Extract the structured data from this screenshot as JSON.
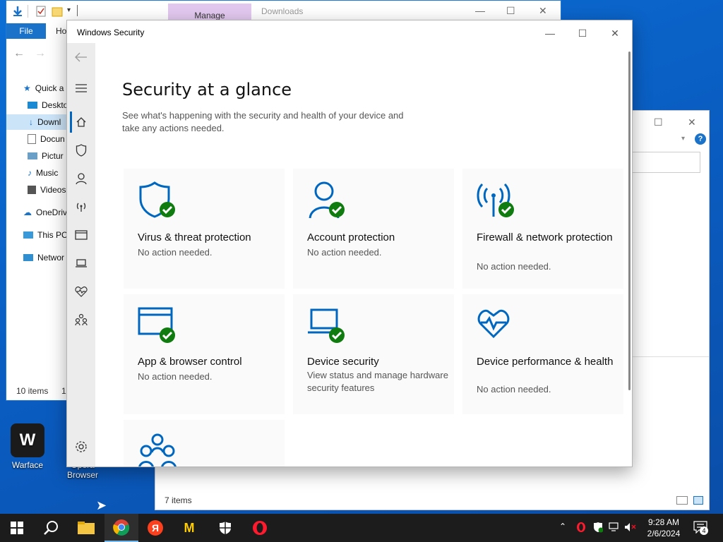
{
  "explorer": {
    "ribbon_tab_file": "File",
    "ribbon_tab_home": "Ho",
    "manage_tab": "Manage",
    "title": "Downloads",
    "sidebar": [
      {
        "label": "Quick a",
        "icon": "star-icon"
      },
      {
        "label": "Deskto",
        "icon": "desktop-icon"
      },
      {
        "label": "Downl",
        "icon": "download-icon"
      },
      {
        "label": "Docun",
        "icon": "document-icon"
      },
      {
        "label": "Pictur",
        "icon": "picture-icon"
      },
      {
        "label": "Music",
        "icon": "music-icon"
      },
      {
        "label": "Videos",
        "icon": "video-icon"
      },
      {
        "label": "OneDriv",
        "icon": "cloud-icon"
      },
      {
        "label": "This PC",
        "icon": "computer-icon"
      },
      {
        "label": "Networ",
        "icon": "network-icon"
      }
    ],
    "status_items": "10 items",
    "status_extra": "1"
  },
  "explorer2": {
    "status_items": "7 items"
  },
  "desktop_icons": [
    {
      "label": "Warface",
      "icon": "warface-icon"
    },
    {
      "label": "Opera Browser",
      "icon": "opera-icon"
    }
  ],
  "security": {
    "window_title": "Windows Security",
    "heading": "Security at a glance",
    "subheading": "See what's happening with the security and health of your device and take any actions needed.",
    "tiles": [
      {
        "title": "Virus & threat protection",
        "desc": "No action needed.",
        "icon": "shield-icon"
      },
      {
        "title": "Account protection",
        "desc": "No action needed.",
        "icon": "person-icon"
      },
      {
        "title": "Firewall & network protection",
        "desc": "No action needed.",
        "icon": "wifi-antenna-icon"
      },
      {
        "title": "App & browser control",
        "desc": "No action needed.",
        "icon": "browser-window-icon"
      },
      {
        "title": "Device security",
        "desc": "View status and manage hardware security features",
        "icon": "laptop-icon"
      },
      {
        "title": "Device performance & health",
        "desc": "No action needed.",
        "icon": "heart-pulse-icon"
      }
    ],
    "nav_icons": [
      "back-arrow-icon",
      "menu-icon",
      "home-icon",
      "shield-icon",
      "person-icon",
      "antenna-icon",
      "browser-icon",
      "laptop-icon",
      "heart-icon",
      "family-icon",
      "settings-icon"
    ]
  },
  "taskbar": {
    "apps": [
      "start-icon",
      "search-icon",
      "file-explorer-icon",
      "chrome-icon",
      "yandex-icon",
      "yandex-music-icon",
      "windows-security-icon",
      "opera-icon"
    ],
    "time": "9:28 AM",
    "date": "2/6/2024",
    "notification_count": "4"
  },
  "colors": {
    "accent": "#0067c0",
    "ok_green": "#107c10",
    "taskbar": "#1c1c1c"
  }
}
